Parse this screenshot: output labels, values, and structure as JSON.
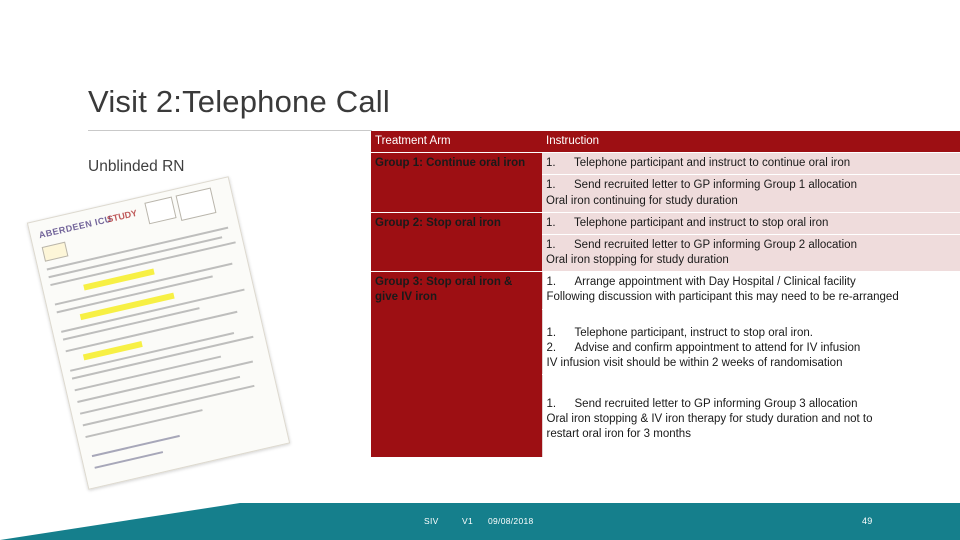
{
  "slide": {
    "title": "Visit 2:Telephone Call",
    "subtitle": "Unblinded RN"
  },
  "photo": {
    "header_left": "ABERDEEN ICU",
    "header_right": "STUDY"
  },
  "table": {
    "headers": {
      "arm": "Treatment Arm",
      "instruction": "Instruction"
    },
    "rows": [
      {
        "arm": "Group 1: Continue oral iron",
        "blocks": [
          {
            "shade": "light",
            "lines": [
              {
                "num": "1.",
                "text": "Telephone participant and instruct to continue oral iron"
              }
            ]
          },
          {
            "shade": "white",
            "lines": [
              {
                "num": "1.",
                "text": "Send recruited letter to GP informing Group 1 allocation"
              },
              {
                "num": "",
                "text": "Oral iron continuing for study duration"
              }
            ]
          }
        ]
      },
      {
        "arm": "Group 2: Stop oral iron",
        "blocks": [
          {
            "shade": "light",
            "lines": [
              {
                "num": "1.",
                "text": "Telephone participant and instruct to stop oral iron"
              }
            ]
          },
          {
            "shade": "white",
            "lines": [
              {
                "num": "1.",
                "text": "Send recruited letter to GP informing Group 2 allocation"
              },
              {
                "num": "",
                "text": "Oral iron stopping for study duration"
              }
            ]
          }
        ]
      },
      {
        "arm": "Group 3: Stop oral iron & give IV iron",
        "blocks": [
          {
            "shade": "white",
            "lines": [
              {
                "num": "1.",
                "text": "Arrange appointment with Day Hospital / Clinical facility"
              },
              {
                "num": "",
                "text": "Following discussion with participant this may need to be re-arranged"
              }
            ]
          },
          {
            "shade": "white",
            "lines": [
              {
                "num": "1.",
                "text": "Telephone participant, instruct to stop oral iron."
              },
              {
                "num": "2.",
                "text": "Advise and confirm appointment to attend for IV infusion"
              },
              {
                "num": "",
                "text": "IV infusion visit should be within 2 weeks of randomisation"
              }
            ]
          },
          {
            "shade": "white",
            "lines": [
              {
                "num": "1.",
                "text": "Send recruited letter to GP informing Group 3 allocation"
              },
              {
                "num": "",
                "text": "Oral iron stopping & IV iron therapy for study duration and not to"
              },
              {
                "num": "",
                "text": "restart oral iron for 3 months"
              }
            ]
          }
        ]
      }
    ]
  },
  "footer": {
    "site": "SIV",
    "version": "V1",
    "date": "09/08/2018",
    "page_number": "49"
  },
  "colors": {
    "table_header": "#9d0f13",
    "band": "#157f8c",
    "row_shade": "#efdcdc",
    "highlight": "#f7ef3a"
  }
}
